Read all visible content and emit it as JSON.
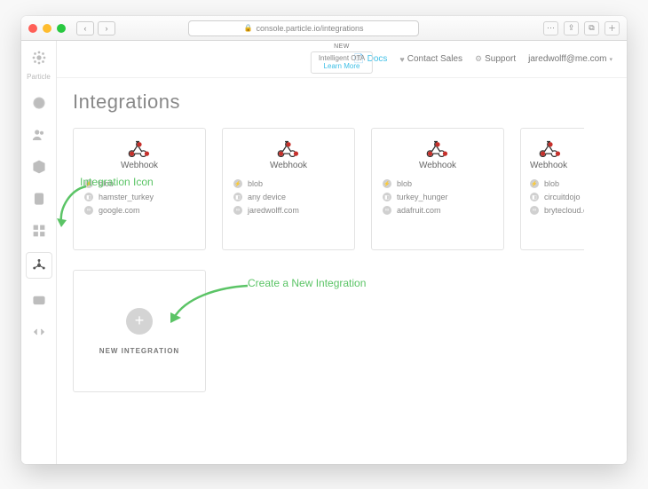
{
  "browser": {
    "url": "console.particle.io/integrations",
    "reader_icon": "⊕"
  },
  "header": {
    "new_badge": "NEW",
    "promo_line1": "Intelligent OTA",
    "promo_line2": "Learn More",
    "docs": "Docs",
    "contact": "Contact Sales",
    "support": "Support",
    "user_email": "jaredwolff@me.com"
  },
  "sidebar": {
    "brand": "Particle"
  },
  "page": {
    "title": "Integrations",
    "new_integration_label": "NEW INTEGRATION"
  },
  "cards": [
    {
      "service": "Webhook",
      "rows": [
        "blob",
        "hamster_turkey",
        "google.com"
      ]
    },
    {
      "service": "Webhook",
      "rows": [
        "blob",
        "any device",
        "jaredwolff.com"
      ]
    },
    {
      "service": "Webhook",
      "rows": [
        "blob",
        "turkey_hunger",
        "adafruit.com"
      ]
    },
    {
      "service": "Webhook",
      "rows": [
        "blob",
        "circuitdojo",
        "brytecloud.com"
      ]
    }
  ],
  "annotations": {
    "integration_icon": "Integration Icon",
    "create_new": "Create a New Integration"
  }
}
